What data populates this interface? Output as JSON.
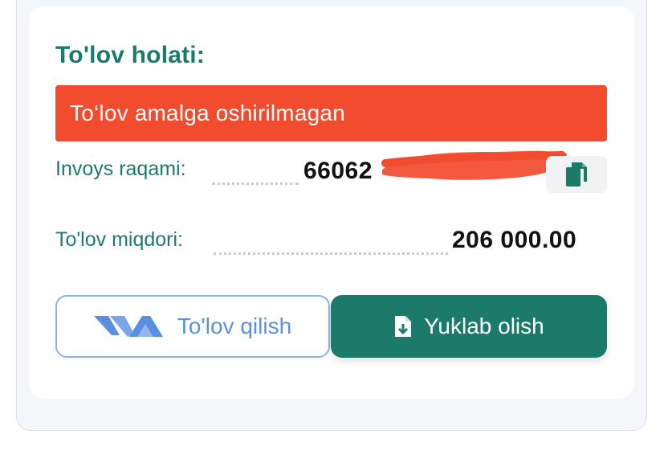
{
  "payment_status": {
    "title": "To'lov holati:",
    "status_text": "To‘lov amalga oshirilmagan",
    "status_color": "#f24b2e"
  },
  "invoice": {
    "label": "Invoys raqami:",
    "value_visible": "66062"
  },
  "amount": {
    "label": "To'lov miqdori:",
    "value": "206 000.00"
  },
  "actions": {
    "pay_label": "To'lov qilish",
    "download_label": "Yuklab olish"
  },
  "icons": {
    "copy": "copy-icon",
    "pay_logo": "payment-provider-logo-icon",
    "download": "file-download-icon"
  },
  "colors": {
    "brand_teal": "#1b7a6a",
    "pay_blue": "#5a8fe0"
  }
}
